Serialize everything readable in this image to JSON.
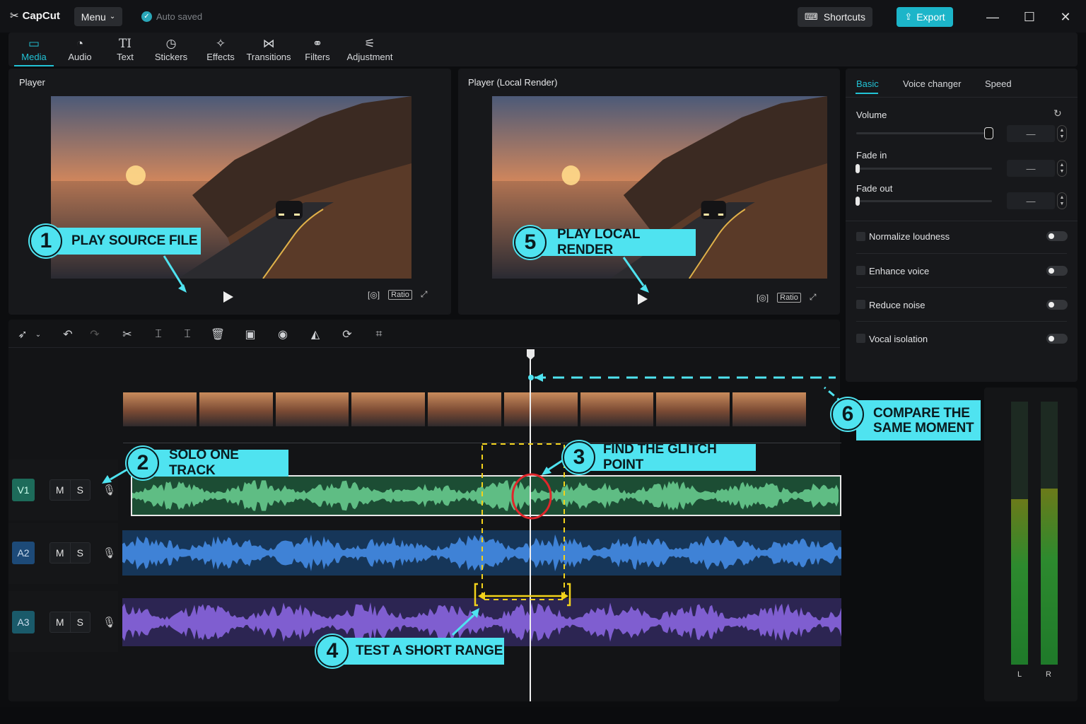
{
  "app": {
    "logo": "CapCut",
    "menu": "Menu",
    "autosave": "Auto saved",
    "shortcuts": "Shortcuts",
    "export": "Export"
  },
  "toolbar": {
    "items": [
      {
        "label": "Media",
        "icon": "media-icon"
      },
      {
        "label": "Audio",
        "icon": "audio-icon"
      },
      {
        "label": "Text",
        "icon": "text-icon"
      },
      {
        "label": "Stickers",
        "icon": "stickers-icon"
      },
      {
        "label": "Effects",
        "icon": "effects-icon"
      },
      {
        "label": "Transitions",
        "icon": "transitions-icon"
      },
      {
        "label": "Filters",
        "icon": "filters-icon"
      },
      {
        "label": "Adjustment",
        "icon": "adjustment-icon"
      }
    ],
    "active": "Media"
  },
  "player_left": {
    "title": "Player",
    "ratio": "Ratio"
  },
  "player_right": {
    "title": "Player (Local Render)",
    "ratio": "Ratio"
  },
  "right_panel": {
    "tabs": [
      "Basic",
      "Voice changer",
      "Speed"
    ],
    "active_tab": "Basic",
    "volume": {
      "label": "Volume",
      "value": "—",
      "level": 1.0
    },
    "fade_in": {
      "label": "Fade in",
      "value": "—",
      "level": 0.0
    },
    "fade_out": {
      "label": "Fade out",
      "value": "—",
      "level": 0.0
    },
    "toggles": [
      {
        "label": "Normalize loudness",
        "on": false
      },
      {
        "label": "Enhance voice",
        "on": false
      },
      {
        "label": "Reduce noise",
        "on": false
      },
      {
        "label": "Vocal isolation",
        "on": false
      }
    ]
  },
  "tracks": [
    {
      "id": "V1",
      "mute": "M",
      "solo": "S",
      "color": "#1d6b5a"
    },
    {
      "id": "A2",
      "mute": "M",
      "solo": "S",
      "color": "#1d4a78"
    },
    {
      "id": "A3",
      "mute": "M",
      "solo": "S",
      "color": "#4a3577"
    }
  ],
  "meters": {
    "left_label": "L",
    "right_label": "R",
    "left_level": 0.63,
    "right_level": 0.67
  },
  "callouts": [
    {
      "num": "1",
      "text": "PLAY SOURCE FILE"
    },
    {
      "num": "2",
      "text": "SOLO ONE TRACK"
    },
    {
      "num": "3",
      "text": "FIND THE GLITCH POINT"
    },
    {
      "num": "4",
      "text": "TEST A SHORT RANGE"
    },
    {
      "num": "5",
      "text": "PLAY LOCAL RENDER"
    },
    {
      "num": "6",
      "text": "COMPARE THE",
      "text2": "SAME MOMENT"
    }
  ],
  "colors": {
    "accent": "#22c3d6",
    "callout": "#4fe3f0",
    "range": "#f2d21b",
    "glitch": "#e0262b"
  }
}
